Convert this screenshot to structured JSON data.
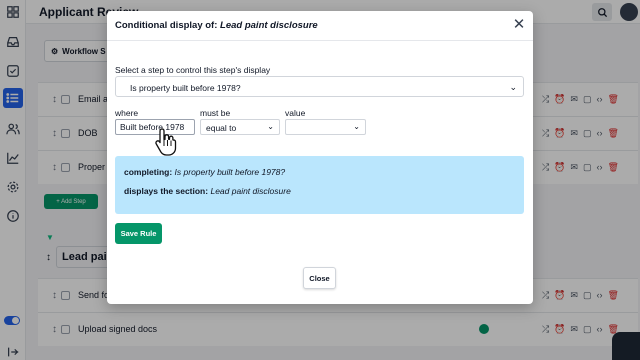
{
  "app": {
    "title": "Applicant Review"
  },
  "toolbar": {
    "workflow_label": "Workflow S"
  },
  "background_rows": [
    {
      "label": "Email a"
    },
    {
      "label": "DOB"
    },
    {
      "label": "Proper"
    }
  ],
  "add_step_label": "+ Add Step",
  "section": {
    "title": "Lead pai"
  },
  "section_rows": [
    {
      "label": "Send fo"
    },
    {
      "label": "Upload signed docs"
    }
  ],
  "modal": {
    "title_prefix": "Conditional display of:",
    "title_target": "Lead paint disclosure",
    "close_icon": "close-icon",
    "step_prompt": "Select a step to control this step's display",
    "step_selected": "Is property built before 1978?",
    "labels": {
      "where": "where",
      "must_be": "must be",
      "value": "value"
    },
    "where_value": "Built before 1978",
    "must_be_value": "equal to",
    "value_selected": "",
    "info": {
      "completing_label": "completing:",
      "completing_value": "Is property built before 1978?",
      "displays_label": "displays the section:",
      "displays_value": "Lead paint disclosure"
    },
    "save_label": "Save Rule",
    "close_label": "Close"
  },
  "colors": {
    "accent": "#059669",
    "info_bg": "#bae6fd",
    "rail_active": "#2563eb"
  }
}
